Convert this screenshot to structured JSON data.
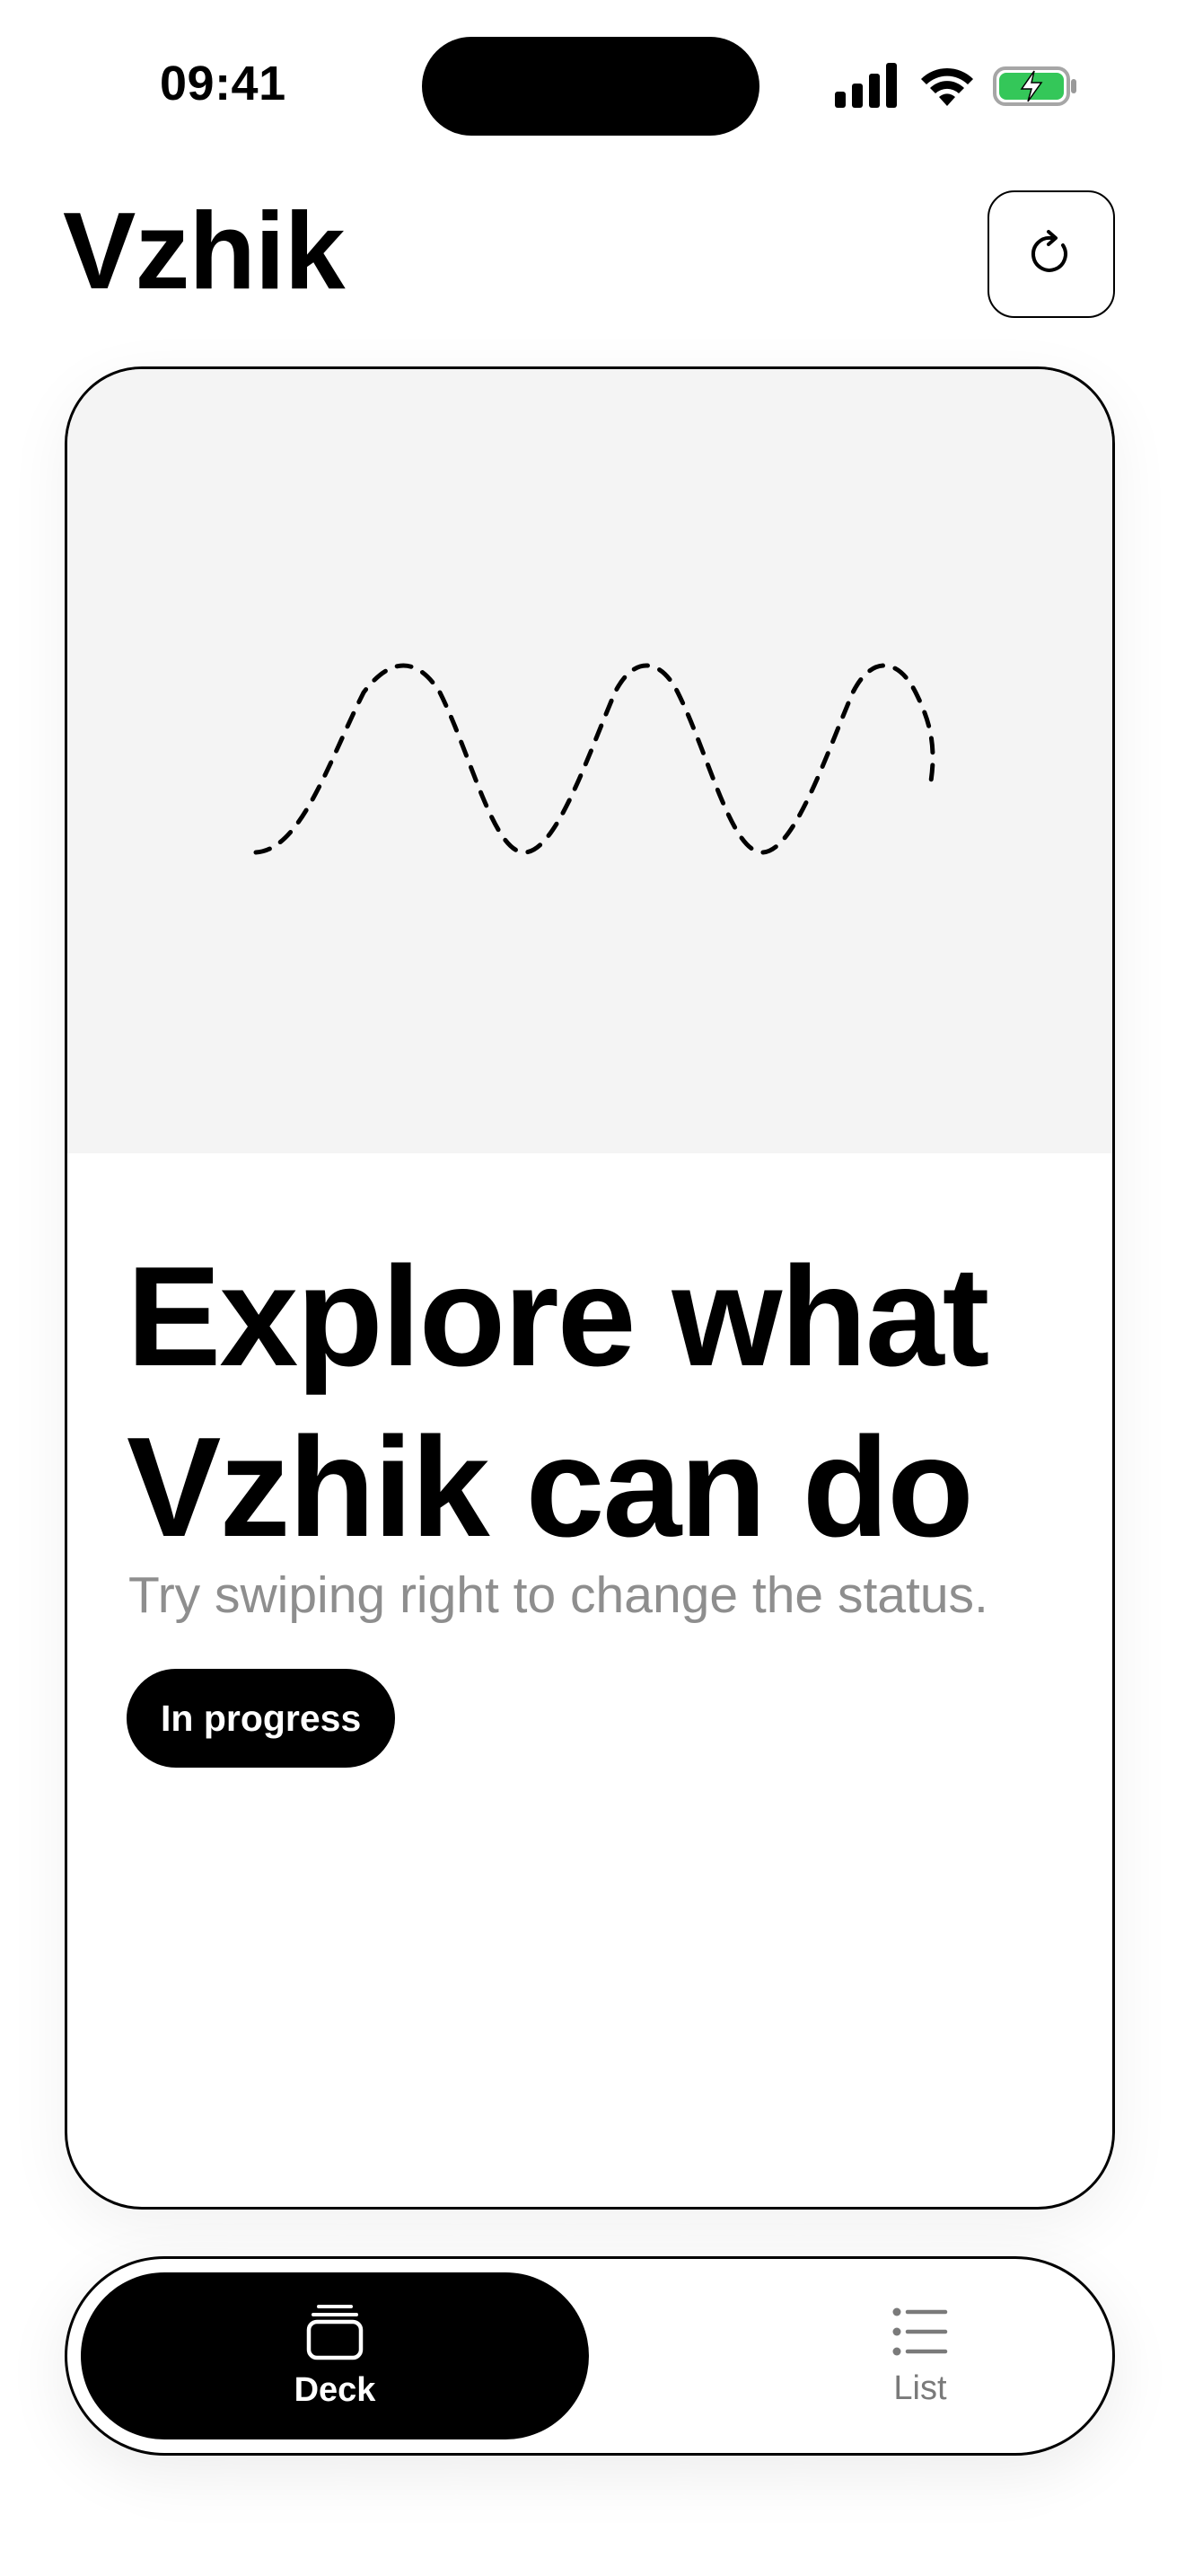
{
  "status_bar": {
    "time": "09:41",
    "icons": [
      "cellular-signal-icon",
      "wifi-icon",
      "battery-charging-icon"
    ],
    "battery_color": "#34c759"
  },
  "header": {
    "title": "Vzhik",
    "refresh_icon": "refresh-icon"
  },
  "card": {
    "illustration": "dashed-wave",
    "title_line1": "Explore what",
    "title_line2": "Vzhik can do",
    "subtitle": "Try swiping right to change the status.",
    "status": "In progress"
  },
  "tab_bar": {
    "tabs": [
      {
        "label": "Deck",
        "icon": "deck-stack-icon",
        "selected": true
      },
      {
        "label": "List",
        "icon": "list-icon",
        "selected": false
      }
    ]
  },
  "colors": {
    "accent": "#000000",
    "illustration_bg": "#f4f4f4",
    "subtitle": "#8e8e8e",
    "inactive_tab": "#7a7a7a"
  }
}
